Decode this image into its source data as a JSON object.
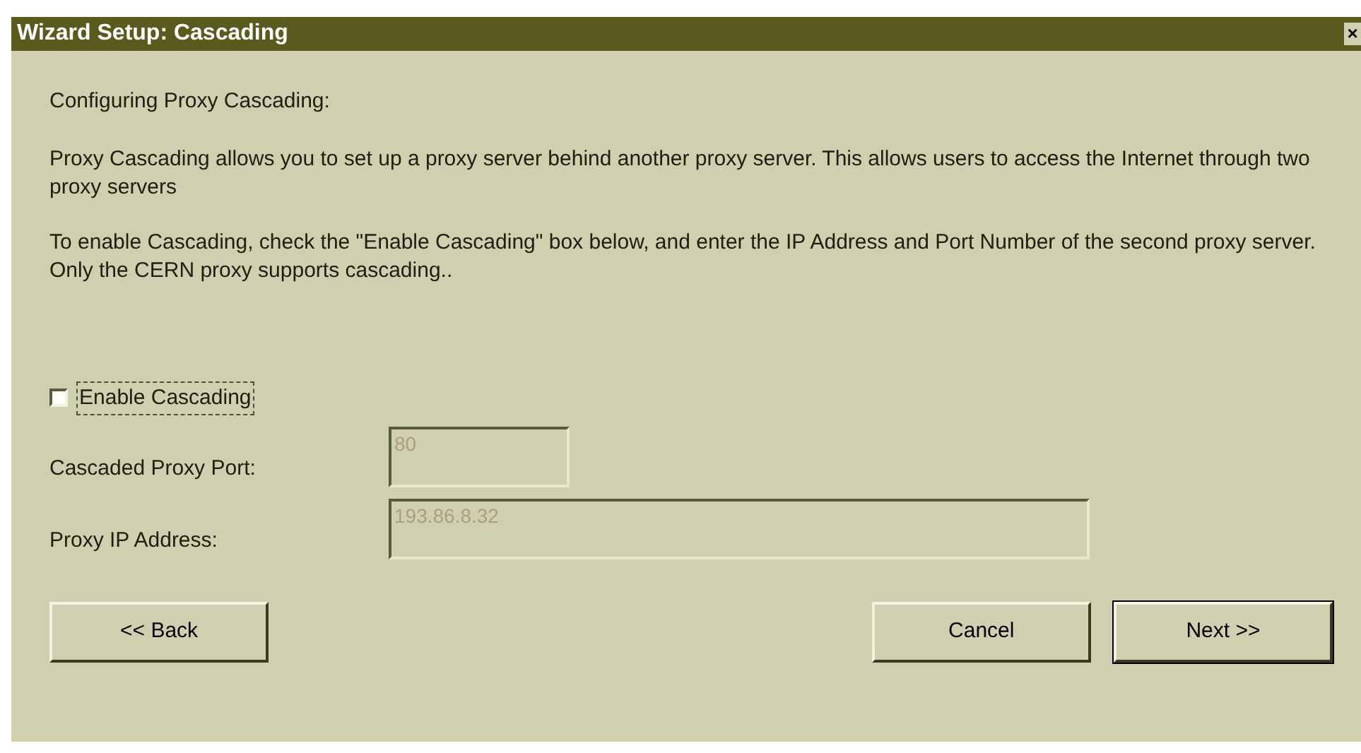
{
  "window": {
    "title": "Wizard Setup: Cascading",
    "close": "×"
  },
  "heading": "Configuring Proxy Cascading:",
  "paragraphs": [
    "Proxy Cascading allows you to set up a proxy server behind another proxy server.  This allows users to access the Internet through two proxy servers",
    "To enable Cascading, check the \"Enable Cascading\" box below, and enter the IP Address and Port Number of the second proxy server.  Only the CERN proxy supports cascading.."
  ],
  "checkbox": {
    "label": "Enable Cascading",
    "checked": false
  },
  "fields": [
    {
      "label": "Cascaded Proxy Port:",
      "value": "80",
      "disabled": true,
      "kind": "short"
    },
    {
      "label": "Proxy IP Address:",
      "value": "193.86.8.32",
      "disabled": true,
      "kind": "long"
    }
  ],
  "buttons": [
    {
      "label": "<< Back",
      "default": false
    },
    {
      "label": "Cancel",
      "default": false
    },
    {
      "label": "Next >>",
      "default": true
    }
  ]
}
